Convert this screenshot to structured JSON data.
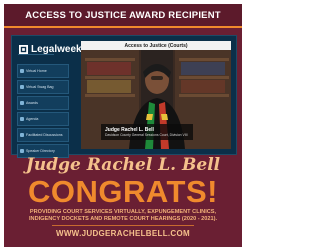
{
  "banner": {
    "title": "ACCESS TO JUSTICE AWARD RECIPIENT"
  },
  "screenshot": {
    "brand": "Legalweek",
    "sidebar": {
      "items": [
        {
          "label": "Virtual Home"
        },
        {
          "label": "Virtual Swag Bag"
        },
        {
          "label": "Awards"
        },
        {
          "label": "Agenda"
        },
        {
          "label": "Facilitated Discussions"
        },
        {
          "label": "Speaker Directory"
        }
      ]
    },
    "video": {
      "title": "Access to Justice (Courts)",
      "caption_name": "Judge Rachel L. Bell",
      "caption_role": "Davidson County General Sessions Court, Division VIII"
    }
  },
  "promo": {
    "name": "Judge Rachel L. Bell",
    "headline": "CONGRATS!",
    "description": "PROVIDING COURT SERVICES VIRTUALLY, EXPUNGEMENT CLINICS, INDIGENCY DOCKETS AND REMOTE COURT HEARINGS (2020 - 2021).",
    "url": "WWW.JUDGERACHELBELL.COM"
  },
  "colors": {
    "background": "#6a1f33",
    "accent": "#f08a2d",
    "panel": "#0b2f49"
  }
}
